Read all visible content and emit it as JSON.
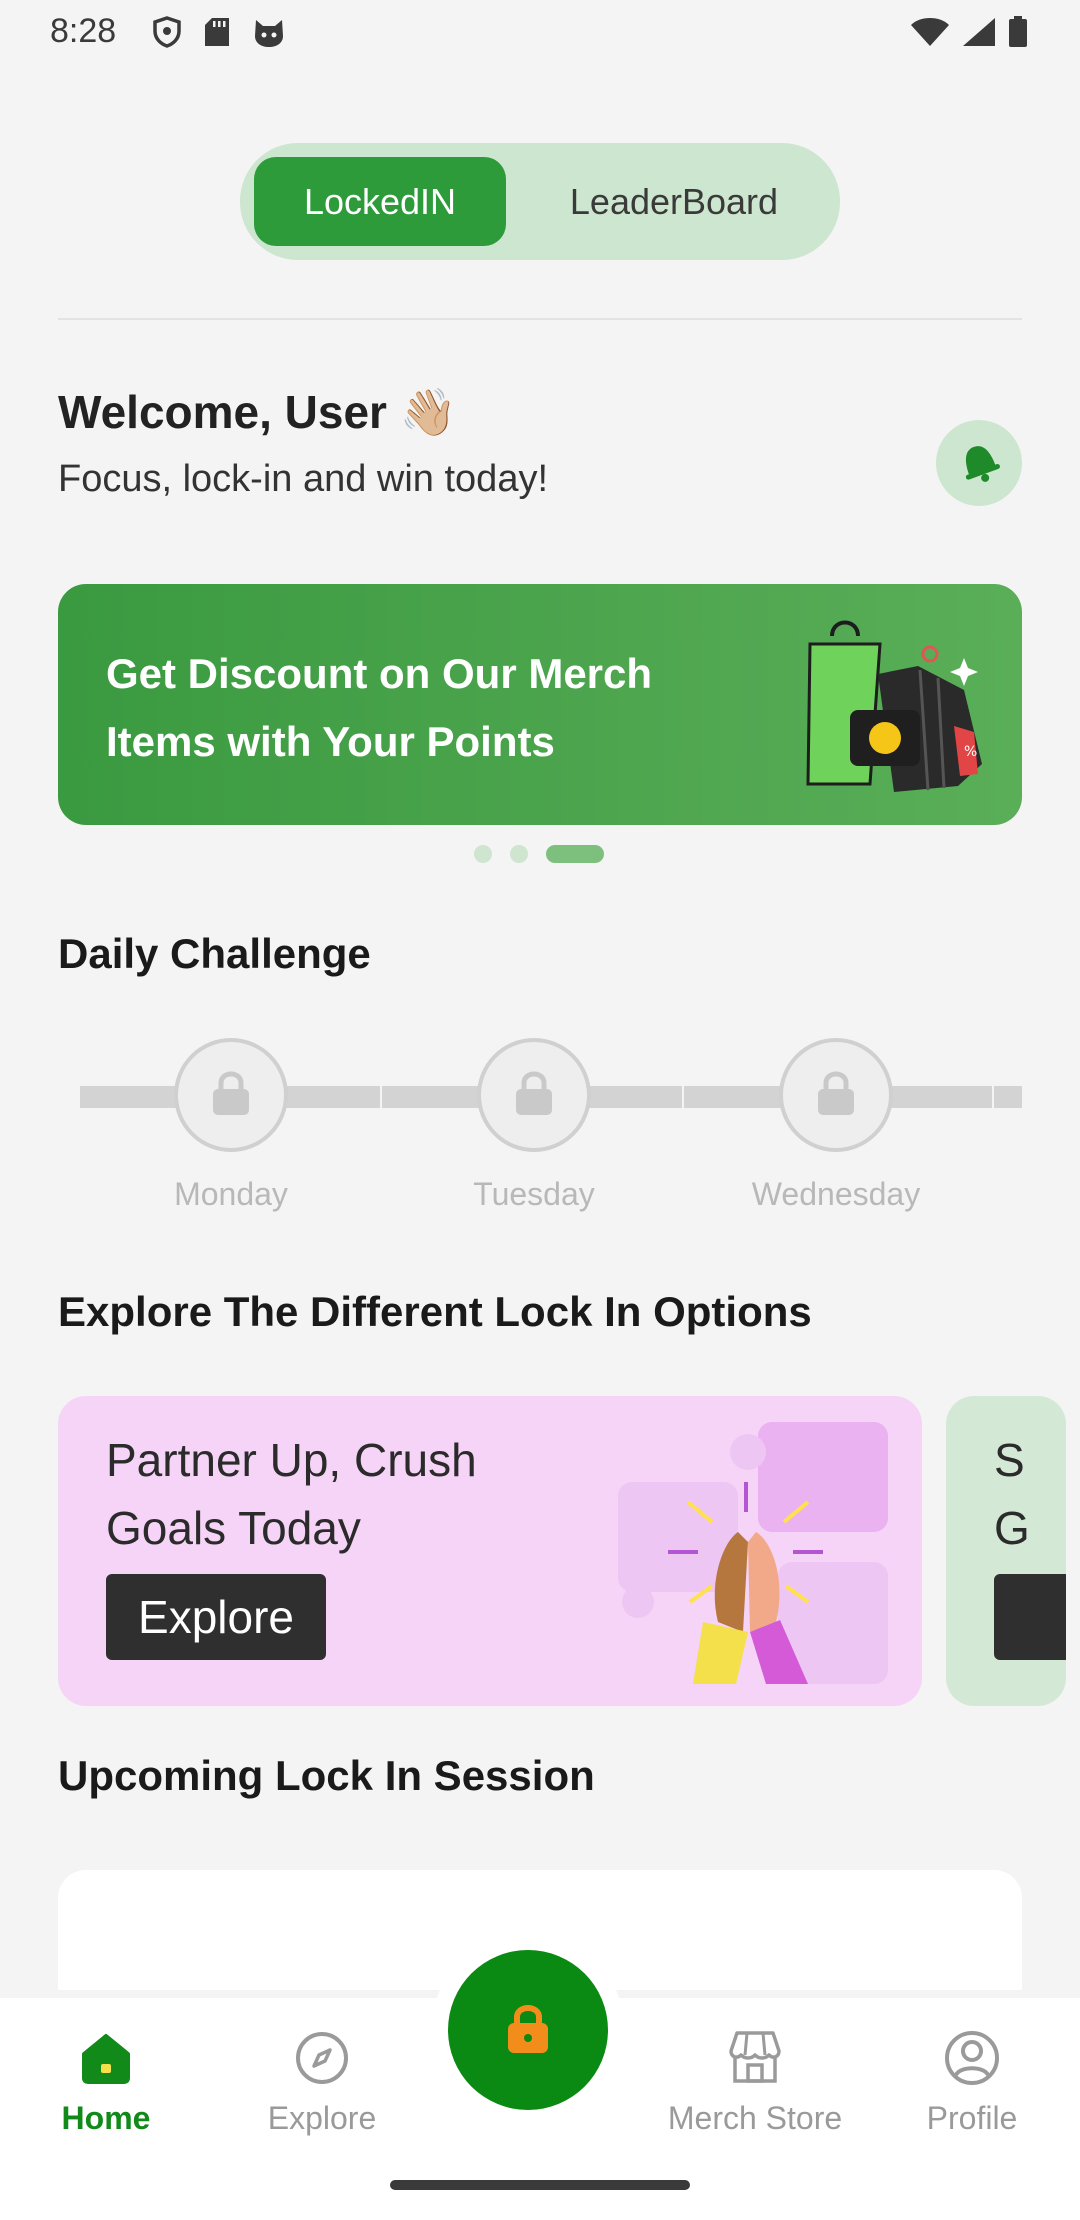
{
  "status_bar": {
    "time": "8:28",
    "left_icons": [
      "shield-icon",
      "sd-card-icon",
      "cat-icon"
    ],
    "right_icons": [
      "wifi-icon",
      "signal-icon",
      "battery-icon"
    ]
  },
  "toggle": {
    "active_label": "LockedIN",
    "inactive_label": "LeaderBoard"
  },
  "welcome": {
    "title": "Welcome, User 👋🏼",
    "subtitle": "Focus, lock-in and win today!"
  },
  "banner": {
    "text": "Get Discount on Our Merch Items with Your Points",
    "page_count": 3,
    "active_page": 3
  },
  "daily_challenge": {
    "title": "Daily Challenge",
    "days": [
      "Monday",
      "Tuesday",
      "Wednesday"
    ]
  },
  "explore": {
    "title": "Explore The Different Lock In Options",
    "cards": [
      {
        "title": "Partner Up, Crush Goals Today",
        "button": "Explore"
      },
      {
        "title_partial": "S\nG"
      }
    ]
  },
  "upcoming": {
    "title": "Upcoming Lock In Session"
  },
  "nav": {
    "items": [
      {
        "label": "Home",
        "icon": "home-icon",
        "active": true
      },
      {
        "label": "Explore",
        "icon": "compass-icon",
        "active": false
      },
      {
        "label": "Merch Store",
        "icon": "store-icon",
        "active": false
      },
      {
        "label": "Profile",
        "icon": "profile-icon",
        "active": false
      }
    ],
    "center_icon": "lock-icon"
  },
  "colors": {
    "primary": "#2e9b3a",
    "fab": "#0a8a12",
    "accent_orange": "#f28c1b",
    "card_pink": "#f5d4f7",
    "toggle_bg": "#cde6cf"
  }
}
